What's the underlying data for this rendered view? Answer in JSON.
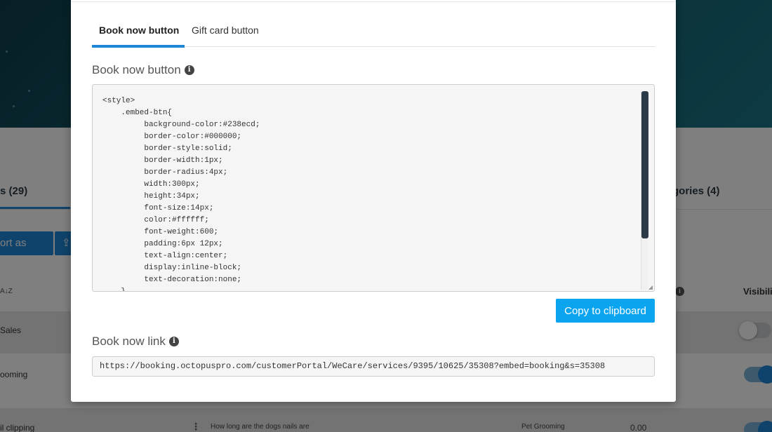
{
  "background": {
    "tab_left_label": "s (29)",
    "tab_right_label": "gories (4)",
    "export_button_label": "ort as (xls)",
    "upload_icon": "upload-icon",
    "sort_icon_label": "A↓Z",
    "info_icon_glyph": "i",
    "visibility_header": "Visibili",
    "rows": [
      {
        "name": "Sales",
        "visible": false
      },
      {
        "name": "ooming",
        "visible": true
      },
      {
        "name": "il clipping",
        "question": "How long are the dogs nails are",
        "category": "Pet Grooming",
        "price": "0.00",
        "visible": true
      }
    ]
  },
  "modal": {
    "tabs": [
      {
        "label": "Book now button",
        "active": true
      },
      {
        "label": "Gift card button",
        "active": false
      }
    ],
    "book_now_section_title": "Book now button",
    "info_glyph": "i",
    "code": "<style>\n    .embed-btn{\n         background-color:#238ecd;\n         border-color:#000000;\n         border-style:solid;\n         border-width:1px;\n         border-radius:4px;\n         width:300px;\n         height:34px;\n         font-size:14px;\n         color:#ffffff;\n         font-weight:600;\n         padding:6px 12px;\n         text-align:center;\n         display:inline-block;\n         text-decoration:none;\n    }",
    "copy_button_label": "Copy to clipboard",
    "book_now_link_title": "Book now link",
    "book_now_link": "https://booking.octopuspro.com/customerPortal/WeCare/services/9395/10625/35308?embed=booking&s=35308"
  },
  "colors": {
    "accent": "#1f87d6",
    "copy_button": "#0ba4ef",
    "scrollbar_thumb": "#2b3a48"
  }
}
